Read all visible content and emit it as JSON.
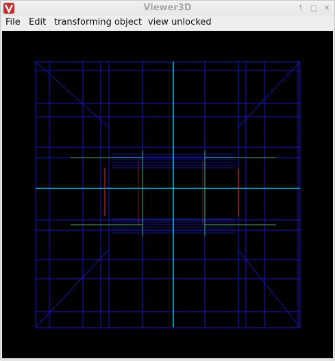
{
  "window": {
    "title": "Viewer3D",
    "controls": {
      "pin": "↑",
      "maximize": "□",
      "close": "✕"
    }
  },
  "menubar": {
    "file": "File",
    "edit": "Edit",
    "mode": "transforming object",
    "view": "view unlocked"
  },
  "viewport": {
    "background": "#000000",
    "wire_color": "#1b1bff",
    "highlight_colors": [
      "#00e0ff",
      "#40ff80",
      "#ff3030"
    ],
    "icons": [
      "app-logo-icon"
    ]
  }
}
